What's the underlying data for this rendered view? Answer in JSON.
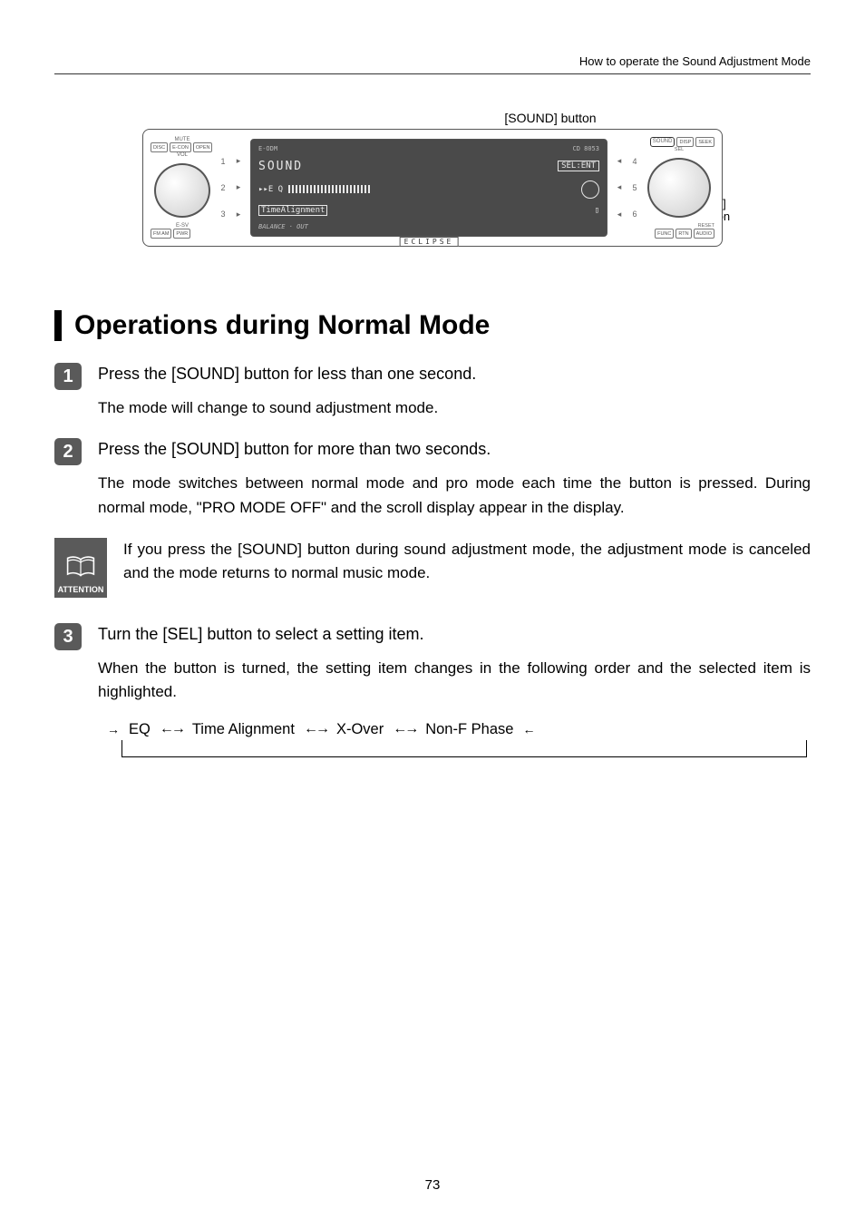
{
  "header": {
    "breadcrumb": "How to operate the Sound Adjustment Mode"
  },
  "diagram": {
    "label_sound": "[SOUND] button",
    "label_sel_line1": "[SEL]",
    "label_sel_line2": "button",
    "device": {
      "top_left_mute": "MUTE",
      "btn_disc": "DISC",
      "btn_econ": "E-CON",
      "btn_open": "OPEN",
      "vol": "VOL",
      "esv": "E-SV",
      "fm_am": "FM AM",
      "pwr": "PWR",
      "model_left": "E-ODM",
      "model_right": "CD 8053",
      "screen_r1_left": "SOUND",
      "screen_r1_right": "SEL:ENT",
      "screen_r2_left": "▸▸E Q",
      "screen_r3_left": "TimeAlignment",
      "balance": "BALANCE · OUT",
      "brand": "ECLIPSE",
      "n1": "1",
      "n2": "2",
      "n3": "3",
      "n4": "4",
      "n5": "5",
      "n6": "6",
      "tri_r": "▸",
      "tri_l": "◂",
      "btn_sound": "SOUND",
      "btn_disp": "DISP",
      "btn_seek": "SEEK",
      "sel": "SEL",
      "reset": "RESET",
      "func": "FUNC",
      "rtn": "RTN",
      "audio": "AUDIO"
    }
  },
  "section": {
    "title": "Operations during Normal Mode"
  },
  "steps": {
    "s1": {
      "num": "1",
      "head": "Press the [SOUND] button for less than one second.",
      "body": "The mode will change to sound adjustment mode."
    },
    "s2": {
      "num": "2",
      "head": "Press the [SOUND] button for more than two seconds.",
      "body": "The mode switches between normal mode and pro mode each time the button is pressed. During normal mode, \"PRO MODE OFF\" and the scroll display appear in the display."
    },
    "attention": {
      "label": "ATTENTION",
      "text": "If you press the [SOUND] button during sound adjustment mode, the adjustment mode is canceled and the mode returns to normal music mode."
    },
    "s3": {
      "num": "3",
      "head": "Turn the [SEL] button to select a setting item.",
      "body": "When the button is turned, the setting item changes in the following order and the selected item is highlighted.",
      "cycle": {
        "i1": "EQ",
        "i2": "Time Alignment",
        "i3": "X-Over",
        "i4": "Non-F Phase"
      }
    }
  },
  "page_number": "73"
}
